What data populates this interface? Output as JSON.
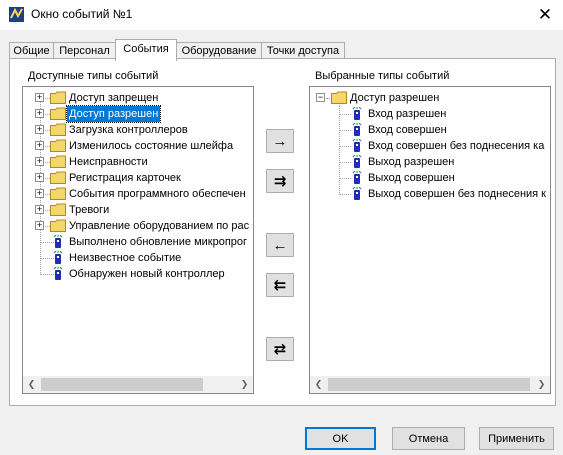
{
  "window": {
    "title": "Окно событий №1"
  },
  "tabs": [
    "Общие",
    "Персонал",
    "События",
    "Оборудование",
    "Точки доступа"
  ],
  "available": {
    "label": "Доступные типы событий",
    "items": [
      {
        "label": "Доступ запрещен",
        "kind": "folder"
      },
      {
        "label": "Доступ разрешен",
        "kind": "folder",
        "selected": true
      },
      {
        "label": "Загрузка контроллеров",
        "kind": "folder"
      },
      {
        "label": "Изменилось состояние шлейфа",
        "kind": "folder"
      },
      {
        "label": "Неисправности",
        "kind": "folder"
      },
      {
        "label": "Регистрация карточек",
        "kind": "folder"
      },
      {
        "label": "События программного обеспечен",
        "kind": "folder"
      },
      {
        "label": "Тревоги",
        "kind": "folder"
      },
      {
        "label": "Управление оборудованием по рас",
        "kind": "folder"
      },
      {
        "label": "Выполнено обновление микропрог",
        "kind": "event"
      },
      {
        "label": "Неизвестное событие",
        "kind": "event"
      },
      {
        "label": "Обнаружен новый контроллер",
        "kind": "event"
      }
    ]
  },
  "selected": {
    "label": "Выбранные типы событий",
    "root": "Доступ разрешен",
    "items": [
      "Вход разрешен",
      "Вход совершен",
      "Вход совершен без поднесения ка",
      "Выход разрешен",
      "Выход совершен",
      "Выход совершен без поднесения к"
    ]
  },
  "transfer": {
    "add": "→",
    "add_all": "⇉",
    "remove": "←",
    "remove_all": "⇇",
    "swap": "⇄"
  },
  "footer": {
    "ok": "OK",
    "cancel": "Отмена",
    "apply": "Применить"
  },
  "colors": {
    "selection": "#0078d7",
    "folder": "#f5d769",
    "event_icon": "#1e2fb4"
  }
}
